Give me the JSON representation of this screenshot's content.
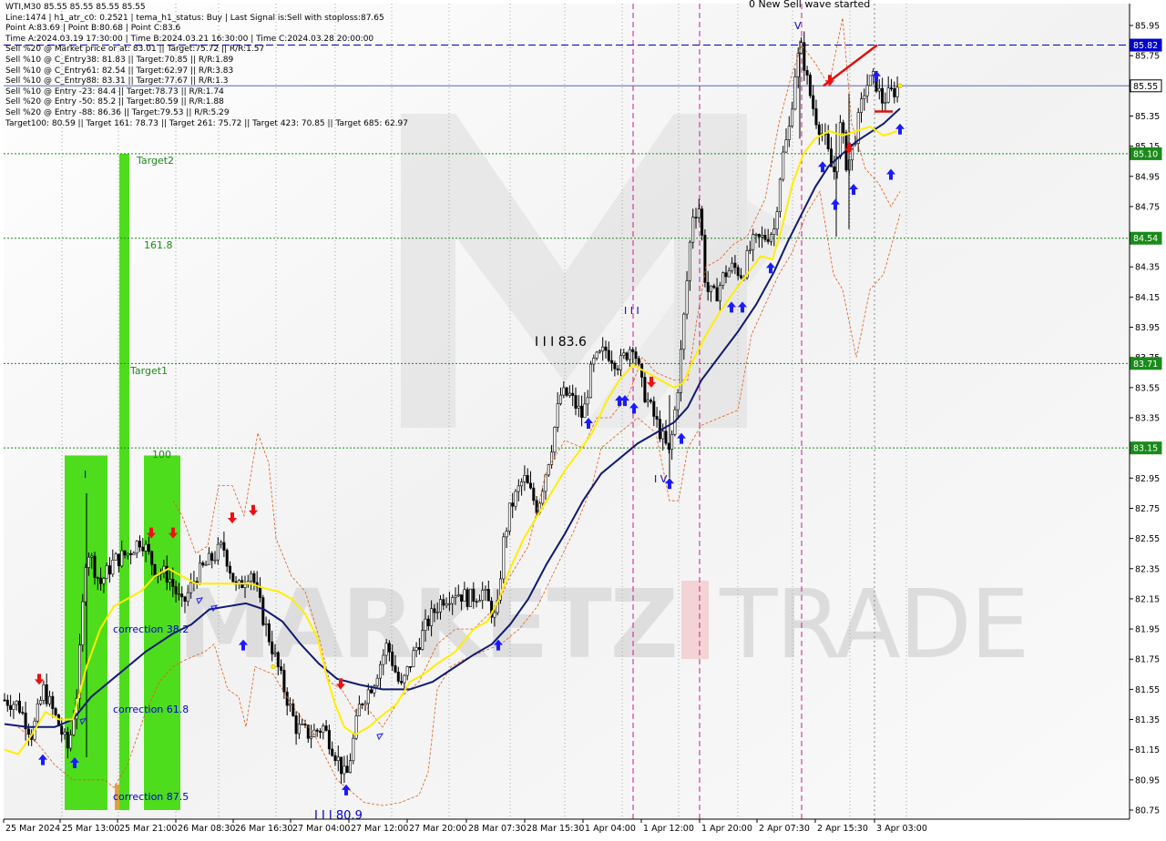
{
  "header": {
    "symbol_line": "WTI,M30  85.55 85.55 85.55 85.55",
    "lines": [
      "Line:1474  |  h1_atr_c0: 0.2521  |  tema_h1_status: Buy  |  Last Signal is:Sell with stoploss:87.65",
      "Point A:83.69  |  Point B:80.68  |  Point C:83.6",
      "Time A:2024.03.19 17:30:00  |  Time B:2024.03.21 16:30:00  |  Time C:2024.03.28 20:00:00",
      "Sell %20 @ Market price or at: 83.01  ||  Target:75.72  ||  R/R:1.57",
      "Sell %10 @ C_Entry38: 81.83  ||  Target:70.85  ||  R/R:1.89",
      "Sell %10 @ C_Entry61: 82.54  ||  Target:62.97  ||  R/R:3.83",
      "Sell %10 @ C_Entry88: 83.31  ||  Target:77.67  ||  R/R:1.3",
      "Sell %10 @ Entry -23: 84.4  ||  Target:78.73  ||  R/R:1.74",
      "Sell %20 @ Entry -50: 85.2  ||  Target:80.59  ||  R/R:1.88",
      "Sell %20 @ Entry -88: 86.36  ||  Target:79.53  ||  R/R:5.29",
      "Target100: 80.59  ||  Target 161: 78.73  ||  Target 261: 75.72  ||  Target 423: 70.85  ||  Target 685: 62.97"
    ]
  },
  "chart_data": {
    "type": "candlestick",
    "symbol": "WTI",
    "timeframe": "M30",
    "current_price": 85.55,
    "ylim": [
      80.75,
      85.95
    ],
    "y_ticks": [
      "85.95",
      "85.75",
      "85.55",
      "85.35",
      "85.15",
      "84.95",
      "84.75",
      "84.55",
      "84.35",
      "84.15",
      "83.95",
      "83.75",
      "83.55",
      "83.35",
      "83.15",
      "82.95",
      "82.75",
      "82.55",
      "82.35",
      "82.15",
      "81.95",
      "81.75",
      "81.55",
      "81.35",
      "81.15",
      "80.95",
      "80.75"
    ],
    "x_ticks": [
      "25 Mar 2024",
      "25 Mar 13:00",
      "25 Mar 21:00",
      "26 Mar 08:30",
      "26 Mar 16:30",
      "27 Mar 04:00",
      "27 Mar 12:00",
      "27 Mar 20:00",
      "28 Mar 07:30",
      "28 Mar 15:30",
      "1 Apr 04:00",
      "1 Apr 12:00",
      "1 Apr 20:00",
      "2 Apr 07:30",
      "2 Apr 15:30",
      "3 Apr 03:00"
    ],
    "levels": [
      {
        "value": 85.82,
        "label": "85.82",
        "style": "dashed",
        "color": "#0000cc"
      },
      {
        "value": 85.55,
        "label": "85.55",
        "style": "solid",
        "color": "#5566bb"
      },
      {
        "value": 85.1,
        "label": "85.10",
        "style": "dotted",
        "color": "#1a8a1a"
      },
      {
        "value": 84.54,
        "label": "84.54",
        "style": "dotted",
        "color": "#1a8a1a"
      },
      {
        "value": 83.71,
        "label": "83.71",
        "style": "dotted",
        "color": "#1a8a1a"
      },
      {
        "value": 83.15,
        "label": "83.15",
        "style": "dotted",
        "color": "#1a8a1a"
      }
    ],
    "annotations": [
      {
        "text": "Target2",
        "x": 70,
        "y": 85.05,
        "color": "#1a8a1a"
      },
      {
        "text": "161.8",
        "x": 75,
        "y": 84.48,
        "color": "#1a8a1a"
      },
      {
        "text": "Target1",
        "x": 70,
        "y": 83.65,
        "color": "#1a8a1a"
      },
      {
        "text": "100",
        "x": 85,
        "y": 83.09,
        "color": "#1a8a1a"
      },
      {
        "text": "correction 38.2",
        "x": 55,
        "y": 81.97,
        "color": "#0000cc"
      },
      {
        "text": "correction 61.8",
        "x": 55,
        "y": 81.43,
        "color": "#0000cc"
      },
      {
        "text": "correction 87.5",
        "x": 55,
        "y": 80.85,
        "color": "#0000cc"
      },
      {
        "text": "I I I 83.6",
        "x": 295,
        "y": 83.82,
        "color": "#000000"
      },
      {
        "text": "I I I 80.9",
        "x": 175,
        "y": 80.73,
        "color": "#0000cc"
      },
      {
        "text": "I I I",
        "x": 345,
        "y": 84.08,
        "color": "#0000cc"
      },
      {
        "text": "I V",
        "x": 360,
        "y": 82.95,
        "color": "#0000cc"
      },
      {
        "text": "I",
        "x": 48,
        "y": 82.97,
        "color": "#0000cc"
      },
      {
        "text": "V",
        "x": 438,
        "y": 85.9,
        "color": "#0000cc"
      },
      {
        "text": "0 New Sell wave started",
        "x": 410,
        "y": 86.0,
        "color": "#000000"
      }
    ],
    "watermark": "MARKETZITRADE"
  }
}
